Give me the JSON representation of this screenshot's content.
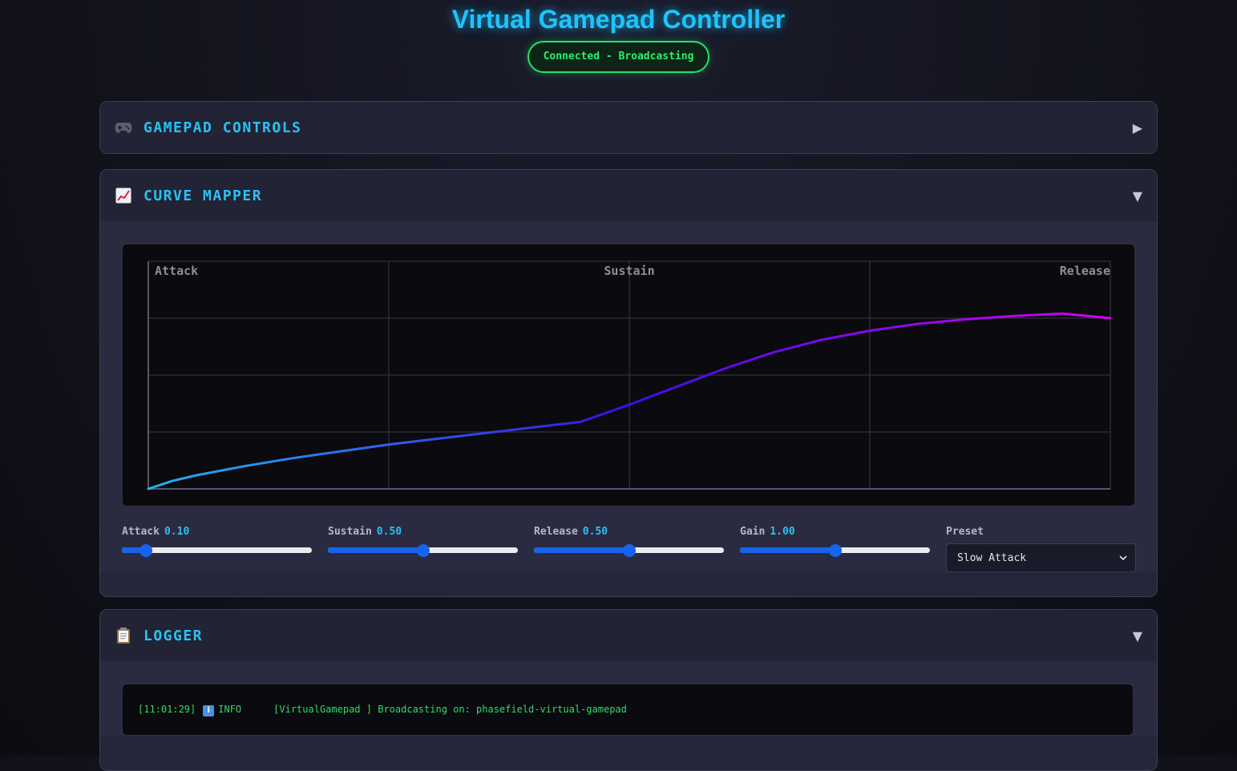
{
  "header": {
    "title": "Virtual Gamepad Controller",
    "status": "Connected - Broadcasting",
    "status_color": "#22e26a",
    "accent": "#1fc3ff"
  },
  "panels": {
    "gamepad": {
      "icon": "gamepad-icon",
      "title": "GAMEPAD CONTROLS",
      "toggle": "▶",
      "expanded": false
    },
    "curve": {
      "icon": "chart-increasing-icon",
      "title": "CURVE MAPPER",
      "toggle": "▼",
      "expanded": true
    },
    "logger": {
      "icon": "clipboard-icon",
      "title": "LOGGER",
      "toggle": "▼",
      "expanded": true
    }
  },
  "curve": {
    "phase_labels": [
      "Attack",
      "Sustain",
      "Release"
    ],
    "controls": [
      {
        "label": "Attack",
        "value": "0.10",
        "fraction": 0.1
      },
      {
        "label": "Sustain",
        "value": "0.50",
        "fraction": 0.5
      },
      {
        "label": "Release",
        "value": "0.50",
        "fraction": 0.5
      },
      {
        "label": "Gain",
        "value": "1.00",
        "fraction": 0.5
      }
    ],
    "preset": {
      "label": "Preset",
      "selected": "Slow Attack"
    },
    "colors": {
      "start": "#1fb4ee",
      "mid": "#3a10e6",
      "end": "#d400f0",
      "grid": "#2a2b36",
      "axis": "#55576a"
    }
  },
  "chart_data": {
    "type": "line",
    "title": "",
    "xlabel": "",
    "ylabel": "",
    "xlim": [
      0,
      1
    ],
    "ylim": [
      0,
      1
    ],
    "grid": true,
    "annotations": [
      "Attack",
      "Sustain",
      "Release"
    ],
    "series": [
      {
        "x": [
          0,
          0.025,
          0.05,
          0.1,
          0.15,
          0.2,
          0.25,
          0.3,
          0.35,
          0.4,
          0.45,
          0.5,
          0.55,
          0.6,
          0.65,
          0.7,
          0.75,
          0.8,
          0.85,
          0.9,
          0.95,
          1.0
        ],
        "values": [
          0,
          0.035,
          0.06,
          0.1,
          0.135,
          0.165,
          0.195,
          0.22,
          0.245,
          0.27,
          0.295,
          0.37,
          0.45,
          0.53,
          0.6,
          0.655,
          0.695,
          0.725,
          0.745,
          0.76,
          0.77,
          0.75
        ]
      }
    ]
  },
  "logger": {
    "entries": [
      {
        "time": "[11:01:29]",
        "level": "INFO",
        "source": "[VirtualGamepad ]",
        "message": "Broadcasting on: phasefield-virtual-gamepad"
      }
    ]
  }
}
